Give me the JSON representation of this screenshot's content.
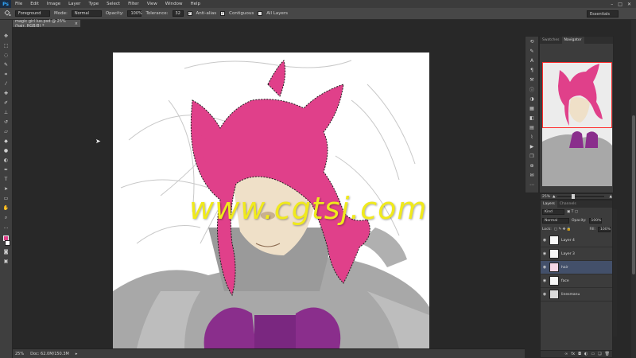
{
  "app": {
    "logo": "Ps",
    "menu": [
      "File",
      "Edit",
      "Image",
      "Layer",
      "Type",
      "Select",
      "Filter",
      "View",
      "Window",
      "Help"
    ],
    "window_controls": [
      "–",
      "□",
      "✕"
    ]
  },
  "options_bar": {
    "fill_source": "Foreground",
    "mode_label": "Mode:",
    "mode_value": "Normal",
    "opacity_label": "Opacity:",
    "opacity_value": "100%",
    "tolerance_label": "Tolerance:",
    "tolerance_value": "32",
    "anti_alias_label": "Anti-alias",
    "contiguous_label": "Contiguous",
    "all_layers_label": "All Layers",
    "workspace": "Essentials"
  },
  "document": {
    "tab_title": "magic girl lux.psd @ 25% (hair, RGB/8) *",
    "close": "×",
    "watermark": "www.cgtsj.com"
  },
  "status_bar": {
    "zoom": "25%",
    "doc_info": "Doc: 62.0M/150.3M"
  },
  "navigator": {
    "tabs": [
      "Swatches",
      "Navigator"
    ],
    "active_tab": "Navigator",
    "zoom": "25%"
  },
  "layers_panel": {
    "tabs": [
      "Layers",
      "Channels"
    ],
    "kind_filter": "Kind",
    "blend_mode": "Normal",
    "opacity_label": "Opacity:",
    "opacity_value": "100%",
    "lock_label": "Lock:",
    "fill_label": "Fill:",
    "fill_value": "100%",
    "layers": [
      {
        "name": "Layer 4",
        "selected": false
      },
      {
        "name": "Layer 3",
        "selected": false
      },
      {
        "name": "hair",
        "selected": true
      },
      {
        "name": "face",
        "selected": false
      },
      {
        "name": "linesmanu",
        "selected": false
      }
    ]
  },
  "colors": {
    "hair": "#e0408a",
    "bow": "#8a2e8c",
    "watermark": "#f0ea1c",
    "selection_highlight": "#43506a"
  },
  "icons": {
    "tools": [
      "move-icon",
      "marquee-icon",
      "lasso-icon",
      "quick-select-icon",
      "crop-icon",
      "eyedropper-icon",
      "healing-icon",
      "brush-icon",
      "clone-stamp-icon",
      "history-brush-icon",
      "eraser-icon",
      "paint-bucket-icon",
      "blur-icon",
      "dodge-icon",
      "pen-icon",
      "type-icon",
      "path-select-icon",
      "shape-icon",
      "hand-icon",
      "zoom-icon"
    ]
  }
}
